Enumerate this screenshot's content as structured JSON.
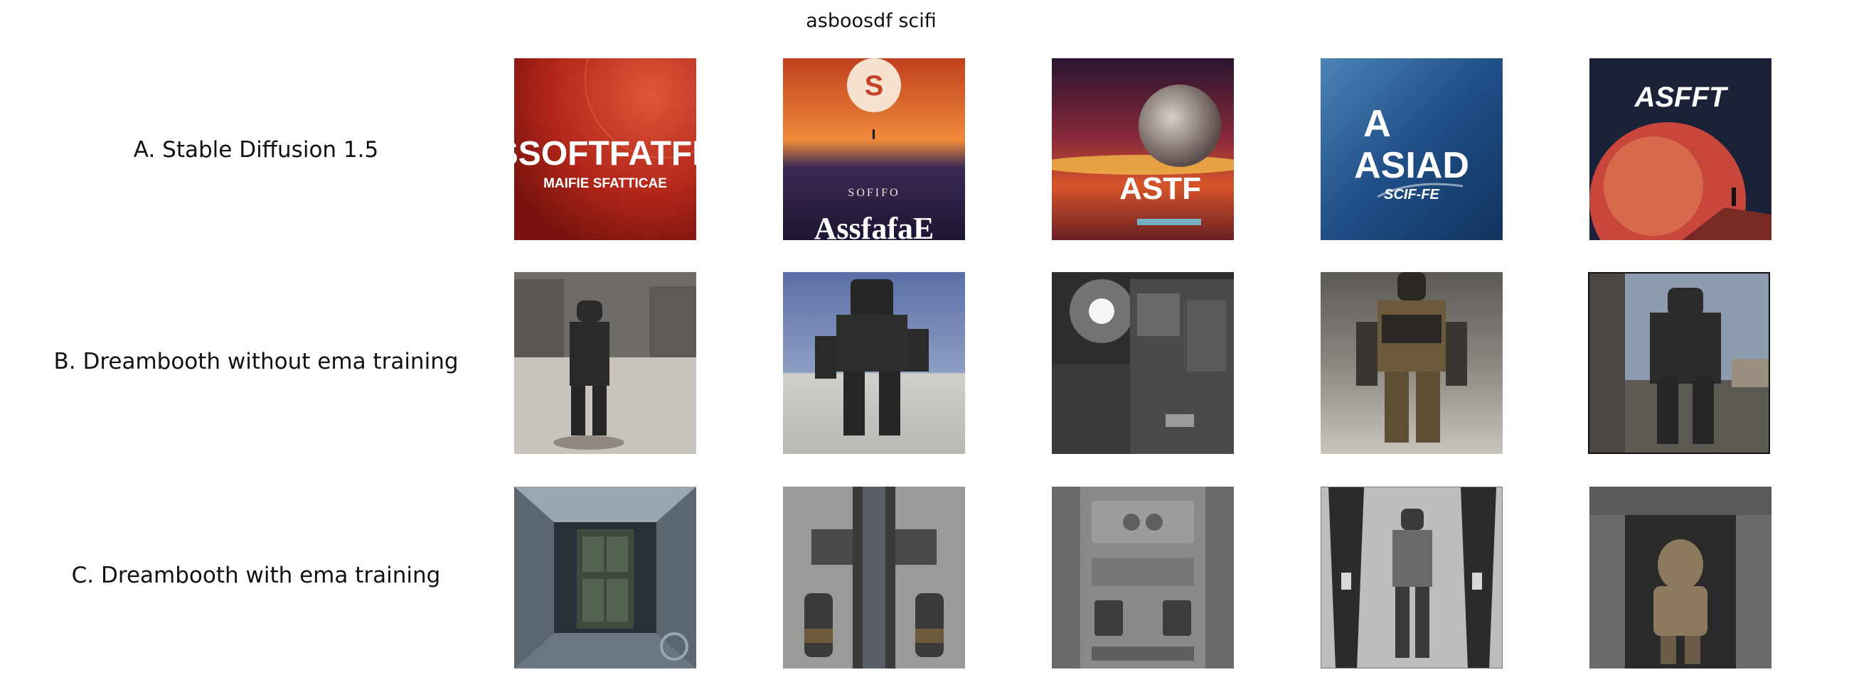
{
  "title": "asboosdf scifi",
  "rows": [
    {
      "label": "A. Stable Diffusion 1.5",
      "images": [
        {
          "depicts": "red poster with large white lettering",
          "lettering": [
            "SSOFTFATFE",
            "MAIFIE SFATTICAE"
          ],
          "colors": [
            "#b3261a",
            "#7a140e",
            "#e0563a"
          ]
        },
        {
          "depicts": "orange sunset planet poster with astronaut",
          "lettering": [
            "SOFIFO",
            "AssfafaE"
          ],
          "colors": [
            "#f08a3a",
            "#3b2a55",
            "#1e1533"
          ]
        },
        {
          "depicts": "moon over orange horizon poster",
          "lettering": [
            "ASTF"
          ],
          "colors": [
            "#2a1430",
            "#d8552a",
            "#f2b94a"
          ]
        },
        {
          "depicts": "blue space poster with white logo",
          "lettering": [
            "A",
            "ASIAD",
            "SCIF-FE"
          ],
          "colors": [
            "#1f4e86",
            "#4d84b8",
            "#ffffff"
          ]
        },
        {
          "depicts": "red planet with figure standing on ridge",
          "lettering": [
            "ASFFT"
          ],
          "colors": [
            "#1b2238",
            "#c8463a",
            "#e58d5c"
          ]
        }
      ]
    },
    {
      "label": "B. Dreambooth without ema training",
      "images": [
        {
          "depicts": "armored soldier standing in hangar",
          "colors": [
            "#6f6c68",
            "#2a2a2a",
            "#c8c3bb"
          ]
        },
        {
          "depicts": "mech robot on salt flat under blue sky",
          "colors": [
            "#5a6fa6",
            "#d0cfca",
            "#262626"
          ]
        },
        {
          "depicts": "dark industrial machinery with bright light",
          "colors": [
            "#2d2d2d",
            "#6a6a6a",
            "#f4f4f4"
          ]
        },
        {
          "depicts": "armored soldier in desert",
          "colors": [
            "#8a8680",
            "#6d5a3c",
            "#2a2724"
          ]
        },
        {
          "depicts": "dark armored figure near building",
          "colors": [
            "#8c9bb0",
            "#5c5852",
            "#2a2a2a"
          ]
        }
      ]
    },
    {
      "label": "C. Dreambooth with ema training",
      "images": [
        {
          "depicts": "sci-fi corridor interior with door",
          "colors": [
            "#5b6670",
            "#2a3038",
            "#9aa7b3"
          ]
        },
        {
          "depicts": "top-down sci-fi mechanical panel",
          "colors": [
            "#7a7a7a",
            "#3a3a38",
            "#6b5a3c"
          ]
        },
        {
          "depicts": "grey sci-fi wall panel with vents",
          "colors": [
            "#8a8a88",
            "#5f5f5d",
            "#3c3c3a"
          ]
        },
        {
          "depicts": "robotic figure between two pillars",
          "colors": [
            "#bdbdbd",
            "#2b2b2b",
            "#6a6a6a"
          ]
        },
        {
          "depicts": "hooded figure inside metal doorway",
          "colors": [
            "#4a4a4a",
            "#8b7a5e",
            "#2a2a2a"
          ]
        }
      ]
    }
  ]
}
